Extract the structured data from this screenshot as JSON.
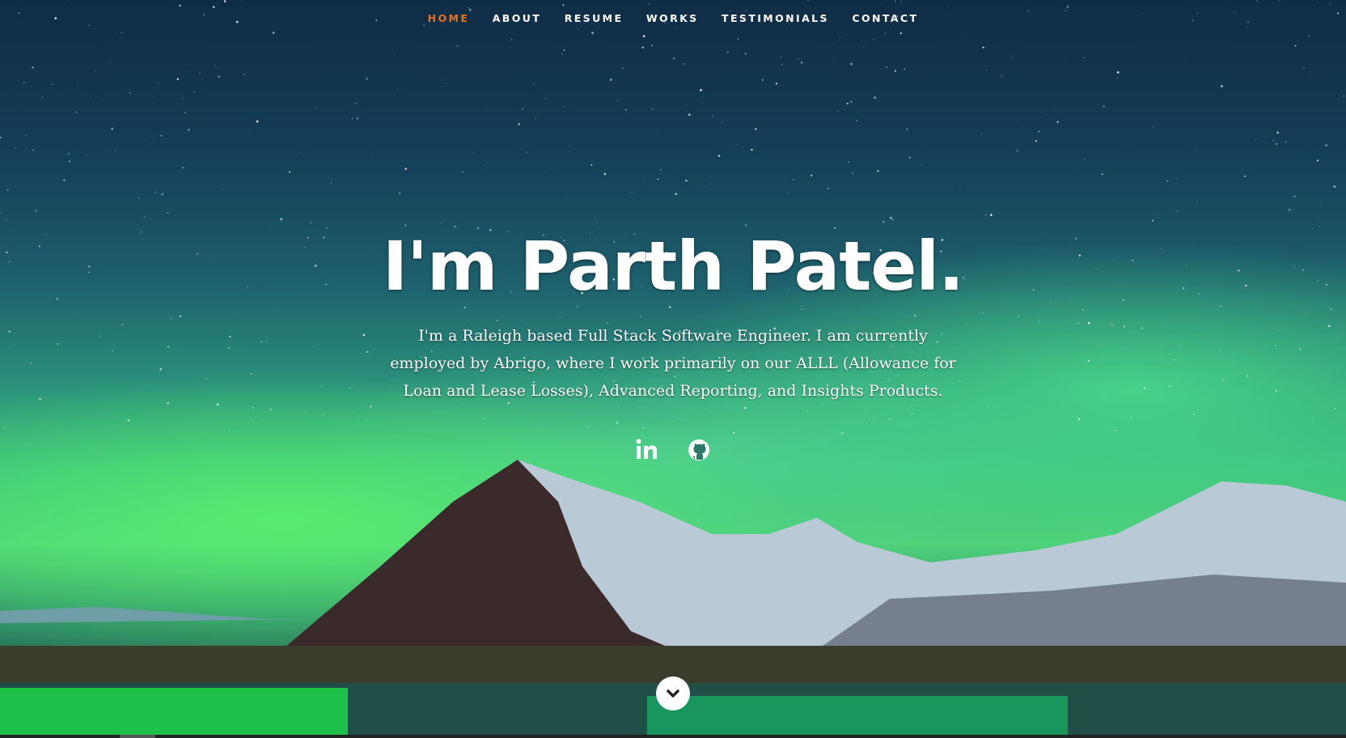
{
  "nav": {
    "items": [
      {
        "label": "HOME",
        "active": true
      },
      {
        "label": "ABOUT"
      },
      {
        "label": "RESUME"
      },
      {
        "label": "WORKS"
      },
      {
        "label": "TESTIMONIALS"
      },
      {
        "label": "CONTACT"
      }
    ]
  },
  "hero": {
    "title": "I'm Parth Patel.",
    "intro": "I'm a Raleigh based Full Stack Software Engineer. I am currently employed by Abrigo, where I work primarily on our ALLL (Allowance for Loan and Lease Losses), Advanced Reporting, and Insights Products."
  },
  "social": [
    {
      "icon": "linkedin-icon"
    },
    {
      "icon": "github-icon"
    }
  ],
  "scroll": {
    "icon": "chevron-down-icon"
  },
  "colors": {
    "accent": "#e8711b",
    "text": "#ffffff"
  }
}
